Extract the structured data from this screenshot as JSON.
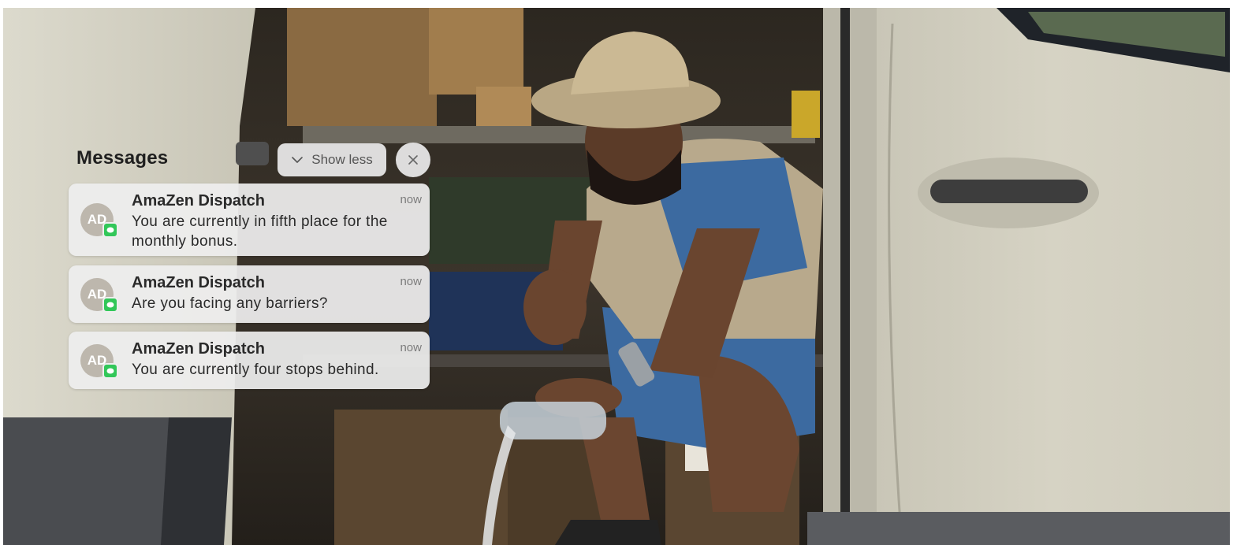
{
  "group": {
    "title": "Messages",
    "show_less_label": "Show less",
    "chevron_icon": "chevron-down-icon",
    "close_icon": "close-icon"
  },
  "notifications": [
    {
      "avatar_initials": "AD",
      "app_icon": "messages-icon",
      "sender": "AmaZen Dispatch",
      "time": "now",
      "body": "You are currently in fifth place for the monthly bonus."
    },
    {
      "avatar_initials": "AD",
      "app_icon": "messages-icon",
      "sender": "AmaZen Dispatch",
      "time": "now",
      "body": "Are you facing any barriers?"
    },
    {
      "avatar_initials": "AD",
      "app_icon": "messages-icon",
      "sender": "AmaZen Dispatch",
      "time": "now",
      "body": "You are currently four stops behind."
    }
  ],
  "colors": {
    "van_body": "#cfcdbf",
    "van_interior": "#3a332a",
    "badge_green": "#32c759",
    "card_background": "#eeeeee"
  }
}
